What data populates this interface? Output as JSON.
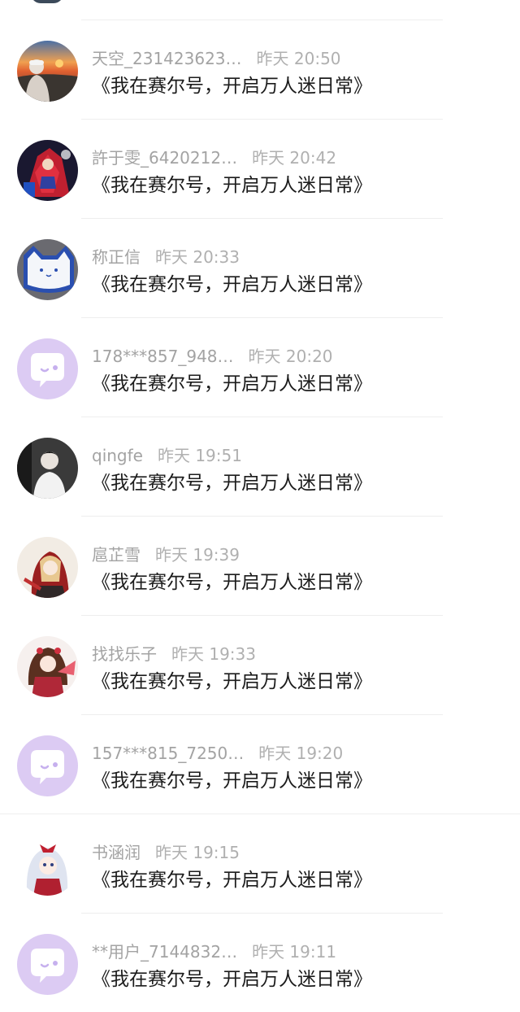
{
  "rows": [
    {
      "name": "天空_231423623…",
      "time": "昨天 20:50",
      "title": "《我在赛尔号，开启万人迷日常》",
      "avatar": "sunset-photo-avatar"
    },
    {
      "name": "許于雯_6420212…",
      "time": "昨天 20:42",
      "title": "《我在赛尔号，开启万人迷日常》",
      "avatar": "figure-toy-avatar"
    },
    {
      "name": "称正信",
      "time": "昨天 20:33",
      "title": "《我在赛尔号，开启万人迷日常》",
      "avatar": "cat-plate-avatar"
    },
    {
      "name": "178***857_948…",
      "time": "昨天 20:20",
      "title": "《我在赛尔号，开启万人迷日常》",
      "avatar": "default-chat-avatar"
    },
    {
      "name": "qingfe",
      "time": "昨天 19:51",
      "title": "《我在赛尔号，开启万人迷日常》",
      "avatar": "portrait-photo-avatar"
    },
    {
      "name": "扈芷雪",
      "time": "昨天 19:39",
      "title": "《我在赛尔号，开启万人迷日常》",
      "avatar": "anime-girl-red-hood-avatar"
    },
    {
      "name": "找找乐子",
      "time": "昨天 19:33",
      "title": "《我在赛尔号，开启万人迷日常》",
      "avatar": "anime-girl-fan-avatar"
    },
    {
      "name": "157***815_7250…",
      "time": "昨天 19:20",
      "title": "《我在赛尔号，开启万人迷日常》",
      "avatar": "default-chat-avatar"
    },
    {
      "name": "书涵润",
      "time": "昨天 19:15",
      "title": "《我在赛尔号，开启万人迷日常》",
      "avatar": "anime-girl-white-hair-avatar"
    },
    {
      "name": "**用户_7144832…",
      "time": "昨天 19:11",
      "title": "《我在赛尔号，开启万人迷日常》",
      "avatar": "default-chat-avatar"
    }
  ]
}
